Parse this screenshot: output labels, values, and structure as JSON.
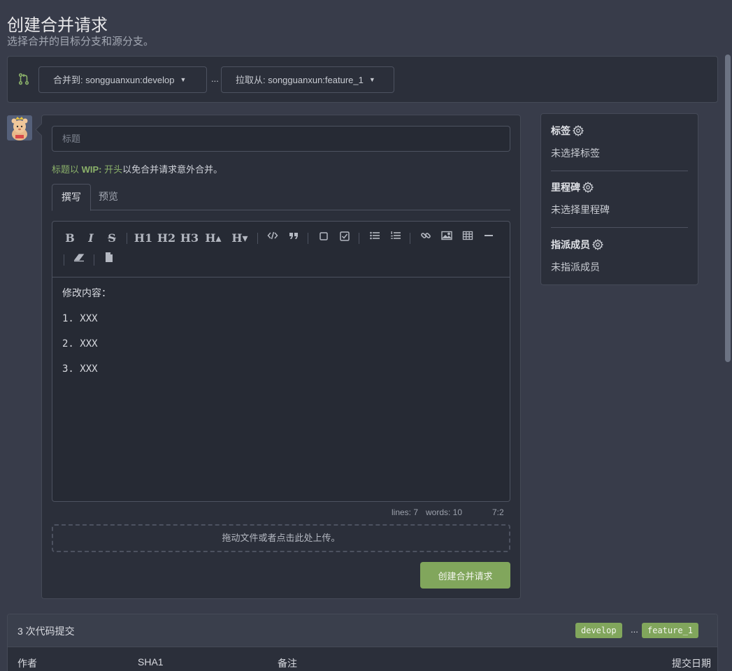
{
  "header": {
    "title": "创建合并请求",
    "subtitle": "选择合并的目标分支和源分支。"
  },
  "branches": {
    "target_label": "合并到: songguanxun:develop",
    "separator": "...",
    "source_label": "拉取从: songguanxun:feature_1"
  },
  "form": {
    "title_placeholder": "标题",
    "wip_hint": {
      "prefix": "标题以 ",
      "wip": "WIP:",
      "middle": " 开头",
      "suffix": "以免合并请求意外合并。"
    },
    "tabs": [
      {
        "label": "撰写",
        "active": true
      },
      {
        "label": "预览",
        "active": false
      }
    ],
    "editor": {
      "toolbar": {
        "bold": "B",
        "italic": "I",
        "strike": "S",
        "h1": "H1",
        "h2": "H2",
        "h3": "H3",
        "h_up": "H▴",
        "h_down": "H▾"
      },
      "content_lines": [
        "修改内容：",
        "1. XXX",
        "2. XXX",
        "3. XXX"
      ]
    },
    "status": {
      "lines": "lines: 7",
      "words": "words: 10",
      "cursor": "7:2"
    },
    "dropzone_text": "拖动文件或者点击此处上传。",
    "submit_label": "创建合并请求"
  },
  "sidebar": {
    "labels": {
      "title": "标签",
      "value": "未选择标签"
    },
    "milestone": {
      "title": "里程碑",
      "value": "未选择里程碑"
    },
    "assignees": {
      "title": "指派成员",
      "value": "未指派成员"
    }
  },
  "commits": {
    "count_label": "3 次代码提交",
    "base_tag": "develop",
    "dots": "...",
    "head_tag": "feature_1",
    "columns": {
      "author": "作者",
      "sha": "SHA1",
      "message": "备注",
      "date": "提交日期"
    }
  },
  "colors": {
    "background": "#383c4a",
    "panel": "#2b2f3a",
    "accent_green": "#81a65c"
  }
}
